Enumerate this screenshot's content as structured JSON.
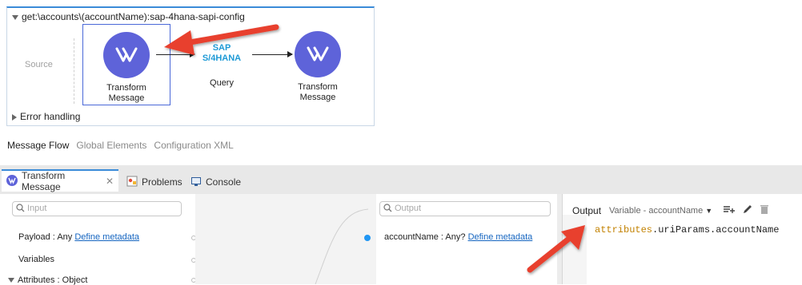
{
  "flow": {
    "title": "get:\\accounts\\(accountName):sap-4hana-sapi-config",
    "source_label": "Source",
    "components": [
      {
        "label_line1": "Transform",
        "label_line2": "Message"
      },
      {
        "logo_line1": "SAP",
        "logo_line2": "S/4HANA",
        "label": "Query"
      },
      {
        "label_line1": "Transform",
        "label_line2": "Message"
      }
    ],
    "error_handling": "Error handling"
  },
  "canvas_tabs": [
    "Message Flow",
    "Global Elements",
    "Configuration XML"
  ],
  "bottom_tabs": [
    {
      "label": "Transform Message",
      "icon": "transform-icon"
    },
    {
      "label": "Problems",
      "icon": "problems-icon"
    },
    {
      "label": "Console",
      "icon": "console-icon"
    }
  ],
  "input_panel": {
    "search_placeholder": "Input",
    "rows": [
      {
        "prefix": "Payload : Any ",
        "link": "Define metadata"
      },
      {
        "prefix": "Variables"
      },
      {
        "prefix": "Attributes : Object"
      }
    ]
  },
  "output_panel": {
    "search_placeholder": "Output",
    "row_prefix": "accountName : Any? ",
    "row_link": "Define metadata"
  },
  "editor": {
    "title": "Output",
    "target": "Variable - accountName",
    "code_kw": "attributes",
    "code_rest": ".uriParams.accountName"
  },
  "colors": {
    "accent": "#3a8bd8",
    "mule_purple": "#5e63d9",
    "callout_red": "#e8412f",
    "sap_blue": "#1e9ad6"
  }
}
